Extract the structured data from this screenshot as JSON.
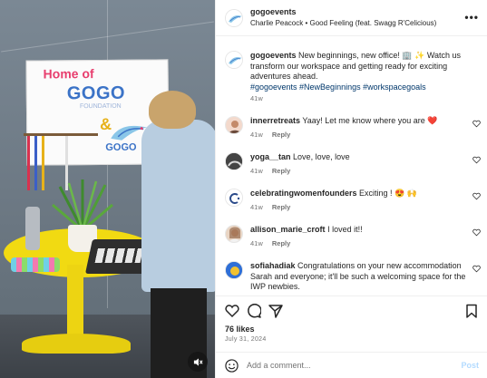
{
  "media": {
    "sign_home": "Home of",
    "sign_gogo": "GOGO",
    "sign_foundation": "FOUNDATION",
    "sign_amp": "&",
    "sign_gogo2": "GOGO",
    "mute_icon": "speaker-muted-icon"
  },
  "header": {
    "username": "gogoevents",
    "audio": "Charlie Peacock • Good Feeling (feat. Swagg R'Celicious)",
    "more_icon": "more-horizontal-icon"
  },
  "caption": {
    "username": "gogoevents",
    "text": "New beginnings, new office! 🏢 ✨ Watch us transform our workspace and getting ready for exciting adventures ahead.",
    "hashtags": "#gogoevents #NewBeginnings #workspacegoals",
    "time": "41w"
  },
  "comments": [
    {
      "username": "innerretreats",
      "text": "Yaay! Let me know where you are ❤️",
      "time": "41w",
      "reply": "Reply"
    },
    {
      "username": "yoga__tan",
      "text": "Love, love, love",
      "time": "41w",
      "reply": "Reply"
    },
    {
      "username": "celebratingwomenfounders",
      "text": "Exciting ! 😍 🙌",
      "time": "41w",
      "reply": "Reply"
    },
    {
      "username": "allison_marie_croft",
      "text": "I loved it!!",
      "time": "41w",
      "reply": "Reply"
    },
    {
      "username": "sofiahadiak",
      "text": "Congratulations on your new accommodation Sarah and everyone; it'll be such a welcoming space for the IWP newbies.",
      "time": "",
      "reply": ""
    }
  ],
  "actions": {
    "like_icon": "heart-icon",
    "comment_icon": "comment-icon",
    "share_icon": "send-icon",
    "save_icon": "bookmark-icon"
  },
  "likes": "76 likes",
  "date": "July 31, 2024",
  "add_comment": {
    "emoji_icon": "emoji-icon",
    "placeholder": "Add a comment...",
    "post_label": "Post"
  }
}
